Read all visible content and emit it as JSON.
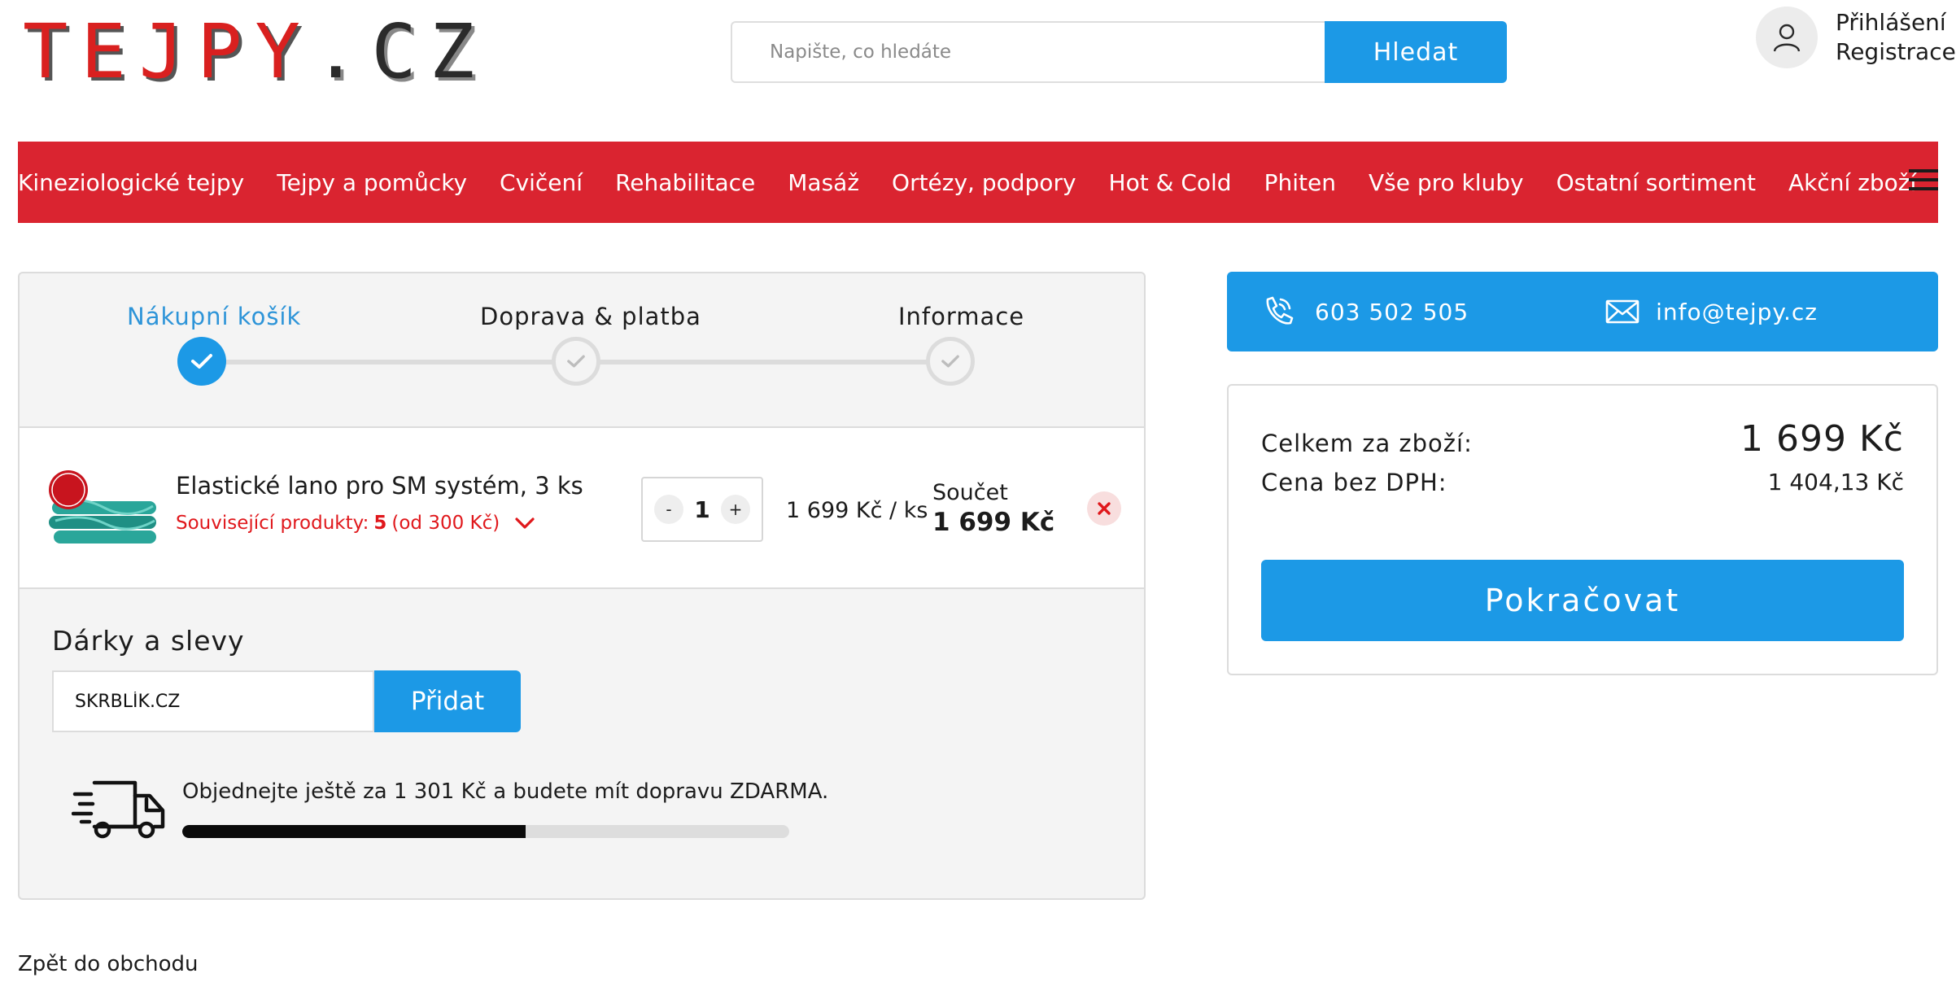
{
  "header": {
    "logo_part1": "TEJPY",
    "logo_dot": ".",
    "logo_part2": "CZ",
    "search_placeholder": "Napište, co hledáte",
    "search_button": "Hledat",
    "login": "Přihlášení",
    "register": "Registrace"
  },
  "nav": {
    "items": [
      "Kineziologické tejpy",
      "Tejpy a pomůcky",
      "Cvičení",
      "Rehabilitace",
      "Masáž",
      "Ortézy, podpory",
      "Hot & Cold",
      "Phiten",
      "Vše pro kluby",
      "Ostatní sortiment",
      "Akční zboží"
    ]
  },
  "steps": [
    {
      "label": "Nákupní košík",
      "state": "active"
    },
    {
      "label": "Doprava & platba",
      "state": "inactive"
    },
    {
      "label": "Informace",
      "state": "inactive"
    }
  ],
  "item": {
    "name": "Elastické lano pro SM systém, 3 ks",
    "related_prefix": "Související produkty:",
    "related_count": "5",
    "related_suffix": "(od 300 Kč)",
    "quantity": "1",
    "qty_minus": "-",
    "qty_plus": "+",
    "unit_price": "1 699 Kč / ks",
    "sum_label": "Součet",
    "sum_value": "1 699 Kč"
  },
  "gifts": {
    "title": "Dárky a slevy",
    "code_value": "SKRBLÍK.CZ",
    "add_button": "Přidat",
    "shipping_text": "Objednejte ještě za 1 301 Kč a budete mít dopravu ZDARMA.",
    "shipping_progress": 0.566
  },
  "back_link": "Zpět do obchodu",
  "contact": {
    "phone": "603 502 505",
    "email": "info@tejpy.cz"
  },
  "summary": {
    "goods_label": "Celkem za zboží:",
    "goods_value": "1 699 Kč",
    "net_label": "Cena bez DPH:",
    "net_value": "1 404,13 Kč",
    "continue_button": "Pokračovat"
  },
  "colors": {
    "accent_blue": "#1c99e6",
    "nav_red": "#da2430",
    "related_red": "#e0181c"
  }
}
